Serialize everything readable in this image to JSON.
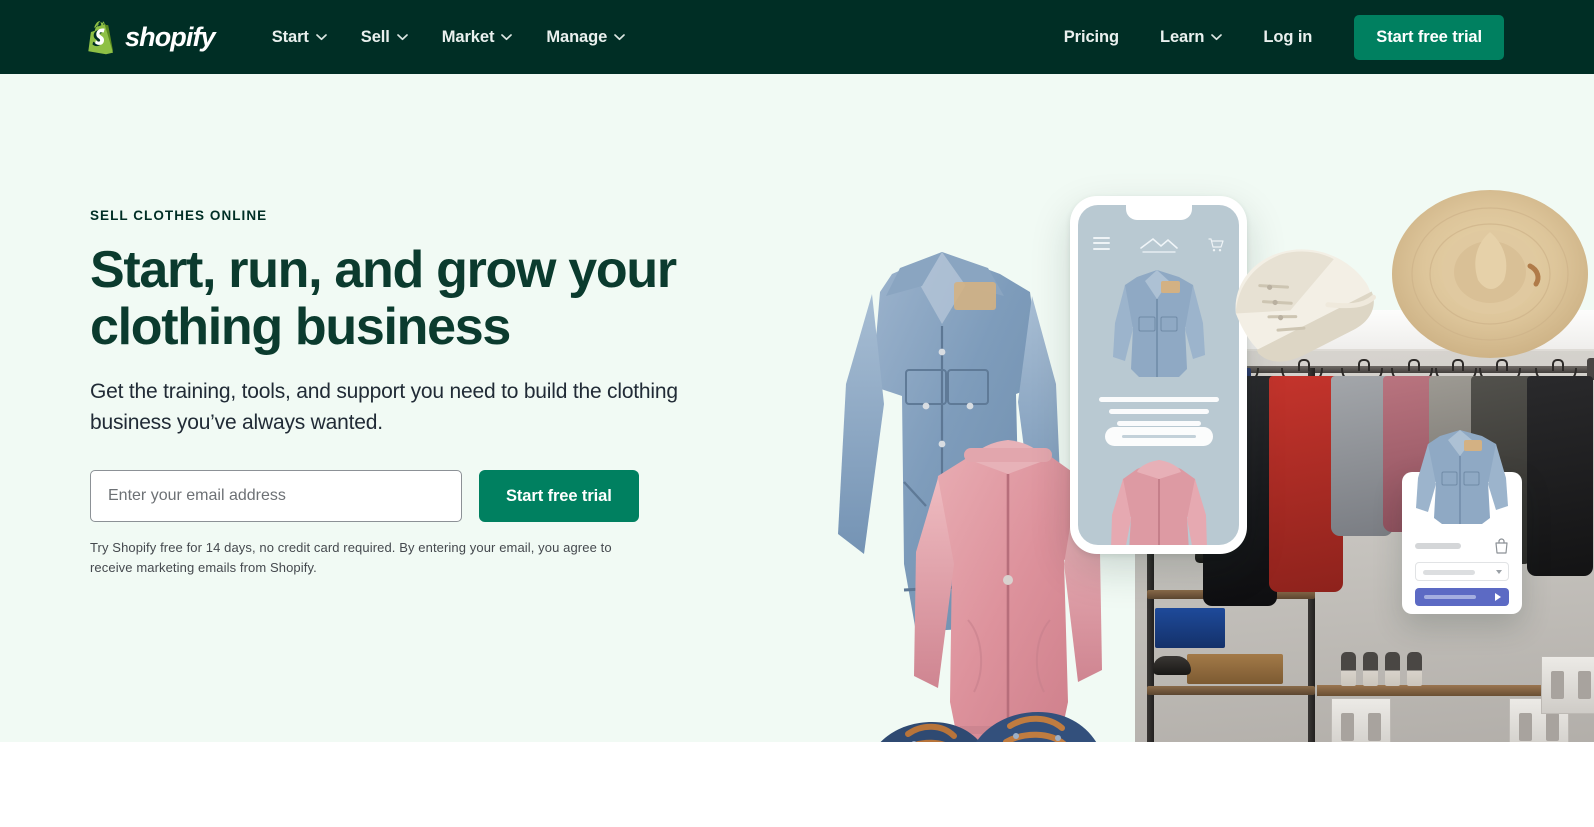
{
  "header": {
    "logo": {
      "name": "shopify-logo",
      "wordmark": "shopify"
    },
    "nav_left": [
      {
        "label": "Start",
        "has_dropdown": true
      },
      {
        "label": "Sell",
        "has_dropdown": true
      },
      {
        "label": "Market",
        "has_dropdown": true
      },
      {
        "label": "Manage",
        "has_dropdown": true
      }
    ],
    "nav_right": [
      {
        "label": "Pricing",
        "has_dropdown": false
      },
      {
        "label": "Learn",
        "has_dropdown": true
      },
      {
        "label": "Log in",
        "has_dropdown": false
      }
    ],
    "cta_label": "Start free trial",
    "background_color": "#002e25",
    "cta_color": "#008060"
  },
  "hero": {
    "eyebrow": "SELL CLOTHES ONLINE",
    "headline": "Start, run, and grow your clothing business",
    "subhead": "Get the training, tools, and support you need to build the clothing business you’ve always wanted.",
    "email_placeholder": "Enter your email address",
    "email_value": "",
    "cta_label": "Start free trial",
    "fineprint": "Try Shopify free for 14 days, no credit card required. By entering your email, you agree to receive marketing emails from Shopify.",
    "background_color": "#f1faf4",
    "heading_color": "#0b3b2e"
  },
  "hero_art": {
    "phone_mockup": {
      "name": "storefront-phone-mockup",
      "screen_color": "#b9c9d2",
      "icons": [
        "hamburger-menu-icon",
        "store-logo-icon",
        "shopping-cart-icon"
      ],
      "products": [
        "denim-jacket",
        "pink-bomber-jacket"
      ]
    },
    "product_card": {
      "name": "product-checkout-card",
      "button_color": "#5c6ac4",
      "icons": [
        "shopping-bag-icon",
        "dropdown-caret-icon",
        "play-arrow-icon"
      ]
    },
    "photo": {
      "name": "clothing-closet-photo",
      "description": "Retail closet rack with hanging jackets, shelves, shoes"
    },
    "floating_items": [
      "denim-jacket",
      "pink-bomber-jacket",
      "cream-canvas-sneaker",
      "straw-fedora-hat",
      "navy-canvas-shoes"
    ]
  }
}
